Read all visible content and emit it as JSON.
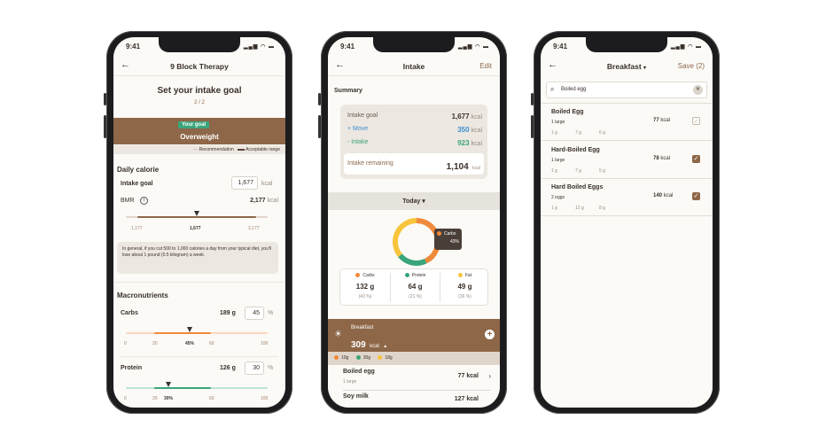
{
  "status_time": "9:41",
  "colors": {
    "brown": "#8d6748",
    "green": "#3aa57a",
    "orange": "#f08a3c",
    "yellow": "#f7c43c",
    "blue": "#3a8fd6"
  },
  "goal": {
    "nav_title": "9 Block Therapy",
    "heading": "Set your intake goal",
    "step": "2 / 2",
    "badge": "Your goal",
    "category": "Overweight",
    "legend_recommendation": "··· Recommendation",
    "legend_range": "Acceptable range",
    "daily_calorie": "Daily calorie",
    "intake_goal_label": "Intake goal",
    "intake_goal_value": "1,677",
    "unit_kcal": "kcal",
    "bmr_label": "BMR",
    "bmr_value": "2,177",
    "slider_min": "1,177",
    "slider_value": "1,677",
    "slider_max": "2,177",
    "info": "In general, if you cut 500 to 1,000 calories a day from your typical diet, you'll lose about 1 pound (0.5 kilogram) a week.",
    "macros_title": "Macronutrients",
    "carbs": {
      "label": "Carbs",
      "grams": "189 g",
      "percent": "45",
      "pct_unit": "%",
      "ticks": [
        "0",
        "20",
        "45%",
        "60",
        "100"
      ],
      "value": 45,
      "range": [
        20,
        60
      ]
    },
    "protein": {
      "label": "Protein",
      "grams": "126 g",
      "percent": "30",
      "pct_unit": "%",
      "ticks": [
        "0",
        "20",
        "30%",
        "60",
        "100"
      ],
      "value": 30,
      "range": [
        20,
        60
      ]
    }
  },
  "intake": {
    "nav_title": "Intake",
    "edit": "Edit",
    "summary": "Summary",
    "rows": [
      {
        "label": "Intake goal",
        "value": "1,677",
        "unit": "kcal"
      },
      {
        "label": "+ Move",
        "value": "350",
        "unit": "kcal"
      },
      {
        "label": "- Intake",
        "value": "923",
        "unit": "kcal"
      }
    ],
    "remaining_label": "Intake remaining",
    "remaining_value": "1,104",
    "remaining_unit": "kcal",
    "period": "Today",
    "tooltip_label": "Carbs",
    "tooltip_value": "43%",
    "donut": [
      {
        "name": "Carbs",
        "percent": 43,
        "color": "#f08a3c"
      },
      {
        "name": "Protein",
        "percent": 21,
        "color": "#3aa57a"
      },
      {
        "name": "Fat",
        "percent": 36,
        "color": "#f7c43c"
      }
    ],
    "macros": [
      {
        "label": "Carbs",
        "grams": "132 g",
        "pct": "(43 %)"
      },
      {
        "label": "Protein",
        "grams": "64 g",
        "pct": "(21 %)"
      },
      {
        "label": "Fat",
        "grams": "49 g",
        "pct": "(36 %)"
      }
    ],
    "meal": {
      "label": "Breakfast",
      "kcal": "309",
      "unit": "kcal",
      "carbs": "10g",
      "protein": "30g",
      "fat": "18g"
    },
    "foods": [
      {
        "name": "Boiled egg",
        "serving": "1 large",
        "kcal": "77 kcal"
      },
      {
        "name": "Soy milk",
        "kcal": "127 kcal"
      }
    ]
  },
  "search": {
    "nav_title": "Breakfast",
    "save": "Save (2)",
    "query": "Boiled egg",
    "results": [
      {
        "name": "Boiled Egg",
        "serving": "1 large",
        "kcal": "77",
        "unit": "kcal",
        "macros": [
          "1 g",
          "7 g",
          "6 g"
        ],
        "checked": false
      },
      {
        "name": "Hard-Boiled Egg",
        "serving": "1 large",
        "kcal": "78",
        "unit": "kcal",
        "macros": [
          "1 g",
          "7 g",
          "5 g"
        ],
        "checked": true
      },
      {
        "name": "Hard Boiled Eggs",
        "serving": "2 eggs",
        "kcal": "140",
        "unit": "kcal",
        "macros": [
          "1 g",
          "12 g",
          "8 g"
        ],
        "checked": true
      }
    ]
  }
}
